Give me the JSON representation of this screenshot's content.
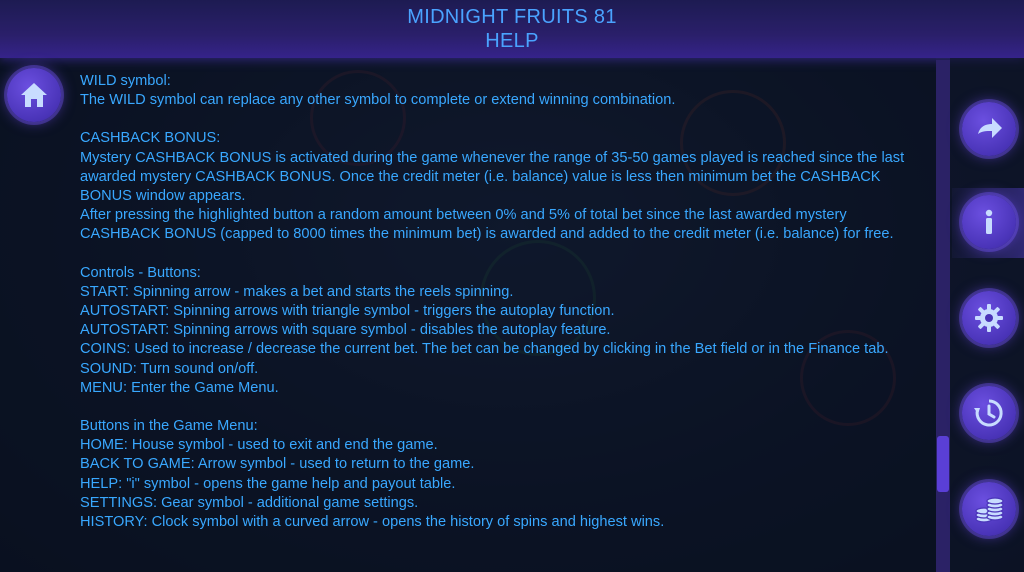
{
  "header": {
    "title": "MIDNIGHT FRUITS 81",
    "subtitle": "HELP"
  },
  "buttons": {
    "home": "home-icon",
    "back": "arrow-right-icon",
    "info": "info-icon",
    "settings": "gear-icon",
    "history": "history-icon",
    "coins": "coins-icon"
  },
  "help": {
    "wild": [
      "WILD symbol:",
      "The WILD symbol can replace any other symbol to complete or extend winning combination."
    ],
    "cashback": [
      "CASHBACK BONUS:",
      "Mystery CASHBACK BONUS is activated during the game whenever the range of 35-50 games played is reached since the last awarded mystery CASHBACK BONUS. Once the credit meter (i.e. balance) value is less then minimum bet the CASHBACK BONUS window appears.",
      "After pressing the highlighted button a random amount between 0% and 5% of total bet since the last awarded mystery CASHBACK BONUS (capped to 8000 times the minimum bet) is awarded and added to the credit meter (i.e. balance) for free."
    ],
    "controls": [
      "Controls - Buttons:",
      "START: Spinning arrow - makes a bet and starts the reels spinning.",
      "AUTOSTART: Spinning arrows with triangle symbol - triggers the autoplay function.",
      "AUTOSTART: Spinning arrows with square symbol - disables the autoplay feature.",
      "COINS: Used to increase / decrease the current bet. The bet can be changed by clicking in the Bet field or in the Finance tab.",
      "SOUND: Turn sound on/off.",
      "MENU: Enter the Game Menu."
    ],
    "menu": [
      "Buttons in the Game Menu:",
      "HOME: House symbol - used to exit and end the game.",
      "BACK TO GAME: Arrow symbol - used to return to the game.",
      "HELP: \"i\" symbol - opens the game help and payout table.",
      "SETTINGS: Gear symbol - additional game settings.",
      "HISTORY: Clock symbol with a curved arrow - opens the history of spins and highest wins."
    ]
  }
}
